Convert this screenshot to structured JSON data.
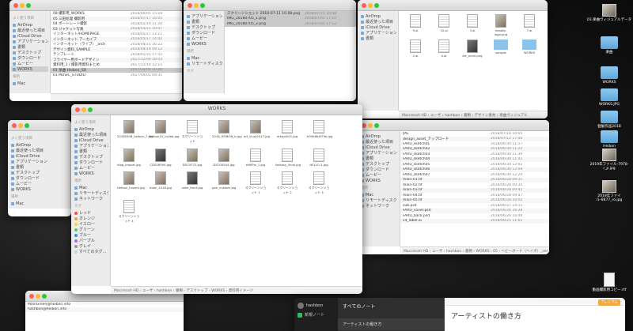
{
  "desktop": {
    "items": [
      {
        "label": "03.楽曲ヴィジュアルデータ",
        "kind": "photo"
      },
      {
        "label": "楽曲",
        "kind": "folder"
      },
      {
        "label": "WORKS",
        "kind": "folder"
      },
      {
        "label": "WORKS.JPG",
        "kind": "folder"
      },
      {
        "label": "個展作品2018",
        "kind": "folder"
      },
      {
        "label": "Heibon",
        "kind": "folder"
      },
      {
        "label": "2019年ファイル-7978-r_p.jpg",
        "kind": "photo"
      },
      {
        "label": "2019年ファイル-8877_ro.jpg",
        "kind": "photo"
      },
      {
        "label": "動画撮影用コピー.rtf",
        "kind": "file"
      }
    ]
  },
  "sidebar_common": {
    "section_favorites": "よく使う項目",
    "items": [
      "AirDrop",
      "最近使った項目",
      "iCloud Drive",
      "アプリケーション",
      "書類",
      "デスクトップ",
      "ダウンロード",
      "ムービー",
      "WORKS"
    ],
    "section_locations": "場所",
    "locations": [
      "Mac",
      "リモートディスク",
      "ネットワーク"
    ],
    "section_tags": "タグ",
    "tags": [
      {
        "label": "レッド",
        "color": "#ff4b4b"
      },
      {
        "label": "オレンジ",
        "color": "#ff9f2a"
      },
      {
        "label": "イエロー",
        "color": "#f5d33b"
      },
      {
        "label": "グリーン",
        "color": "#4fcf57"
      },
      {
        "label": "ブルー",
        "color": "#3d8bf6"
      },
      {
        "label": "パープル",
        "color": "#b46ae0"
      },
      {
        "label": "グレイ",
        "color": "#9a9a9a"
      },
      {
        "label": "すべてのタグ…",
        "color": "#cfcfcf"
      }
    ]
  },
  "win1": {
    "rows": [
      {
        "n": "08 撮影用_WORKS",
        "d": "2018/06/05 15:29"
      },
      {
        "n": "05 三田処理 撮影用",
        "d": "2018/07/17 16:05"
      },
      {
        "n": "04 ポートレート撮影",
        "d": "2018/02/10 11:20"
      },
      {
        "n": "03 ジャケット写真",
        "d": "2018/03/21 10:07"
      },
      {
        "n": "インターネット/HOMEPAGE",
        "d": "2018/05/27 13:11"
      },
      {
        "n": "インターネット アーカイブ",
        "d": "2018/05/17 14:02"
      },
      {
        "n": "インターネット（ライブ）_arch",
        "d": "2018/04/21 16:22"
      },
      {
        "n": "デザイン資料_SAMPLE",
        "d": "2018/04/19 09:12"
      },
      {
        "n": "テンプレート",
        "d": "2018/01/31 17:51"
      },
      {
        "n": "フライヤー用ボードデザイン",
        "d": "2017/12/09 18:03"
      },
      {
        "n": "資料用_1 / 撮影用資料まとめ",
        "d": "2017/11/10 12:15"
      },
      {
        "n": "01 楽曲 Heibon_SD",
        "d": "2017/10/05 10:40"
      },
      {
        "n": "01 MUSIC_STUDIO",
        "d": "2017/09/01 09:31"
      }
    ]
  },
  "win2": {
    "rows": [
      {
        "n": "スクリーンショット 2018-07-11 10.08.png",
        "d": "2018/07/11 10:08"
      },
      {
        "n": "IMG_20180705_1.png",
        "d": "2018/07/05 17:10"
      },
      {
        "n": "IMG_20180705_2.png",
        "d": "2018/07/05 17:12"
      }
    ]
  },
  "win3": {
    "items": [
      {
        "label": "9.ai",
        "kind": "doc"
      },
      {
        "label": "10.ai",
        "kind": "doc"
      },
      {
        "label": "3.ai",
        "kind": "doc"
      },
      {
        "label": "header-logo.png",
        "kind": "photo"
      },
      {
        "label": "7.ai",
        "kind": "doc"
      },
      {
        "label": "2.ai",
        "kind": "doc"
      },
      {
        "label": "4.ai",
        "kind": "doc"
      },
      {
        "label": "art_main.png",
        "kind": "dark"
      },
      {
        "label": "sample",
        "kind": "folder"
      },
      {
        "label": "WORKS",
        "kind": "folder"
      }
    ],
    "path": "Macintosh HD › ユーザ › hashbon › 書類 › デザイン素材 › 楽曲ヴィジュアル"
  },
  "win4": {
    "title": "WORKS",
    "items": [
      {
        "label": "20180408_heibon_7.jpg",
        "kind": "photo"
      },
      {
        "label": "Heibon10_collab.jpg",
        "kind": "photo"
      },
      {
        "label": "スクリーンショット",
        "kind": "doc"
      },
      {
        "label": "2018_HEIBON_b.jpg",
        "kind": "photo"
      },
      {
        "label": "art_illust2017.jpg",
        "kind": "photo"
      },
      {
        "label": "artwork01.jpg",
        "kind": "doc"
      },
      {
        "label": "b39e6b4f79e.jpg",
        "kind": "doc"
      },
      {
        "label": "blog_import.jpg",
        "kind": "photo"
      },
      {
        "label": "CD026590.jpg",
        "kind": "dark"
      },
      {
        "label": "DSC0772.jpg",
        "kind": "photo"
      },
      {
        "label": "DSC00544.jpg",
        "kind": "photo"
      },
      {
        "label": "eNKPw_1.jpg",
        "kind": "doc"
      },
      {
        "label": "fantasy_illust.jpg",
        "kind": "doc"
      },
      {
        "label": "HELLO-1.jpg",
        "kind": "doc"
      },
      {
        "label": "Heibon_Lovers.jpg",
        "kind": "photo"
      },
      {
        "label": "main_2018.jpg",
        "kind": "photo"
      },
      {
        "label": "note_front.jpg",
        "kind": "dark"
      },
      {
        "label": "pair_custom.jpg",
        "kind": "photo"
      },
      {
        "label": "スクリーンショット 1",
        "kind": "doc"
      },
      {
        "label": "スクリーンショット 2",
        "kind": "doc"
      },
      {
        "label": "スクリーンショット 3",
        "kind": "doc"
      },
      {
        "label": "スクリーンショット 4",
        "kind": "doc"
      }
    ],
    "path": "Macintosh HD › ユーザ › hashbon › 書類 › デスクトップ › WORKS › 資料用イメージ"
  },
  "win5": {
    "rows": [
      {
        "n": "JPG",
        "d": "2018/07/18 10:05"
      },
      {
        "n": "design_asset_アップロード",
        "d": "2018/07/12 17:40"
      },
      {
        "n": "FARU_sketch01",
        "d": "2018/06/30 11:17"
      },
      {
        "n": "FARU_sketch02",
        "d": "2018/06/30 11:22"
      },
      {
        "n": "FARU_sketch03",
        "d": "2018/06/30 11:30"
      },
      {
        "n": "FARU_sketch04",
        "d": "2018/06/30 11:41"
      },
      {
        "n": "FARU_sketch05",
        "d": "2018/06/30 12:02"
      },
      {
        "n": "FARU_sketch06",
        "d": "2018/06/30 12:09"
      },
      {
        "n": "FARU_sketch07",
        "d": "2018/06/30 12:20"
      },
      {
        "n": "main-01.tif",
        "d": "2018/06/28 09:31"
      },
      {
        "n": "main-02.tif",
        "d": "2018/06/28 09:35"
      },
      {
        "n": "main-03.tif",
        "d": "2018/06/28 09:41"
      },
      {
        "n": "main-04.tif",
        "d": "2018/06/28 09:47"
      },
      {
        "n": "main-05.tif",
        "d": "2018/06/28 10:02"
      },
      {
        "n": "sub.psd",
        "d": "2018/06/27 14:11"
      },
      {
        "n": "FARU_cover.psd",
        "d": "2018/06/26 16:28"
      },
      {
        "n": "FARU_back.psd",
        "d": "2018/06/26 16:40"
      },
      {
        "n": "cd_label.ai",
        "d": "2018/06/25 11:02"
      }
    ],
    "path": "Macintosh HD › ユーザ › hashbon › 書類 › WORKS › 05 › ヘビーボード（ヘイボ）_ver"
  },
  "win6": {
    "rows": [
      {
        "n": "MainGreen@heibon.info",
        "d": ""
      },
      {
        "n": "hashbon@heibon.info",
        "d": ""
      }
    ]
  },
  "note_app": {
    "title": "すべてのノート",
    "sidebar_user": "hashbon",
    "sidebar_item": "新規ノート",
    "note_title_list": "アーティストの働き方",
    "note_heading": "アーティストの働き方",
    "badge": "プレミアム"
  }
}
